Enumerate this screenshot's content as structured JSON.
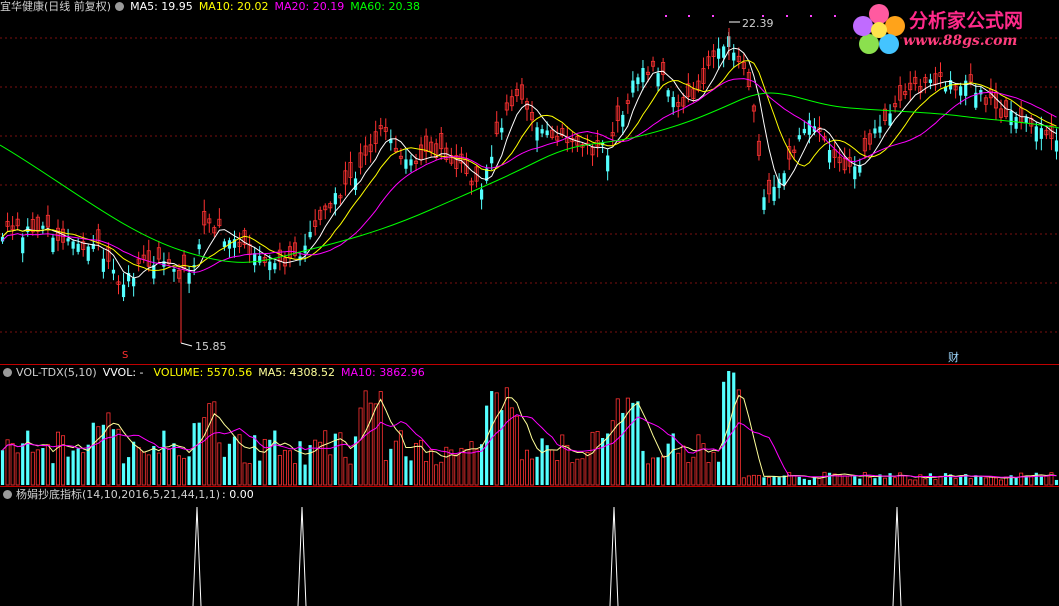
{
  "price_panel": {
    "title": "宜华健康(日线 前复权)",
    "ma5": "MA5: 19.95",
    "ma10": "MA10: 20.02",
    "ma20": "MA20: 20.19",
    "ma60": "MA60: 20.38",
    "high_label": "22.39",
    "low_label": "15.85",
    "marker_s": "S",
    "marker_cai": "财"
  },
  "volume_panel": {
    "name": "VOL-TDX(5,10)",
    "vvol": "VVOL: -",
    "volume": "VOLUME: 5570.56",
    "ma5": "MA5: 4308.52",
    "ma10": "MA10: 3862.96"
  },
  "indicator_panel": {
    "name": "杨娟抄底指标(14,10,2016,5,21,44,1,1)",
    "value": ": 0.00"
  },
  "logo": {
    "brand": "分析家公式网",
    "url": "www.88gs.com"
  },
  "colors": {
    "up": "#ff3232",
    "down": "#54ffff",
    "ma5": "#ffffff",
    "ma10": "#ffff00",
    "ma20": "#ff00ff",
    "ma60": "#00ff00",
    "divider": "#c00000"
  }
}
